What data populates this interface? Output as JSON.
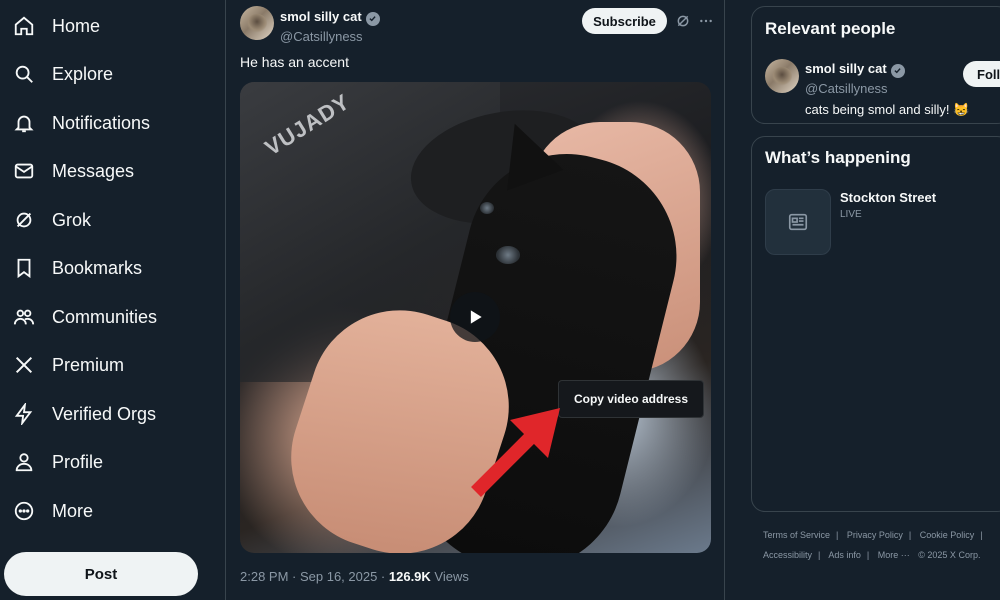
{
  "nav": {
    "items": [
      {
        "label": "Home",
        "icon": "home-icon"
      },
      {
        "label": "Explore",
        "icon": "search-icon"
      },
      {
        "label": "Notifications",
        "icon": "bell-icon"
      },
      {
        "label": "Messages",
        "icon": "mail-icon"
      },
      {
        "label": "Grok",
        "icon": "grok-icon"
      },
      {
        "label": "Bookmarks",
        "icon": "bookmark-icon"
      },
      {
        "label": "Communities",
        "icon": "communities-icon"
      },
      {
        "label": "Premium",
        "icon": "x-logo-icon"
      },
      {
        "label": "Verified Orgs",
        "icon": "lightning-icon"
      },
      {
        "label": "Profile",
        "icon": "person-icon"
      },
      {
        "label": "More",
        "icon": "more-circle-icon"
      }
    ],
    "post_label": "Post"
  },
  "tweet": {
    "author_name": "smol silly cat",
    "author_handle": "@Catsillyness",
    "subscribe_label": "Subscribe",
    "text": "He has an accent",
    "video_watermark": "VUJADY",
    "tooltip": "Copy video address",
    "time": "2:28 PM · Sep 16, 2025 · ",
    "views_count": "126.9K",
    "views_label": " Views"
  },
  "relevant": {
    "title": "Relevant people",
    "name": "smol silly cat",
    "handle": "@Catsillyness",
    "bio": "cats being smol and silly! 😸",
    "follow_label": "Follo"
  },
  "happening": {
    "title": "What’s happening",
    "trend_title": "Stockton Street",
    "trend_status": "LIVE"
  },
  "footer": {
    "row1": [
      "Terms of Service",
      "Privacy Policy",
      "Cookie Policy"
    ],
    "row2": [
      "Accessibility",
      "Ads info",
      "More ···",
      "© 2025 X Corp."
    ]
  },
  "colors": {
    "background": "#15202b",
    "border": "#38444d",
    "secondary_text": "#8b98a5",
    "annotation_arrow": "#e0262a"
  }
}
